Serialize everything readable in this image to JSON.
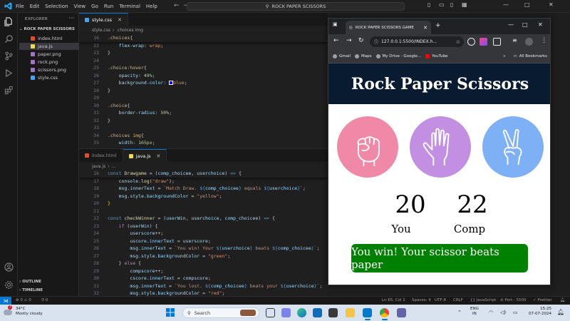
{
  "vscode": {
    "menus": [
      "File",
      "Edit",
      "Selection",
      "View",
      "Go",
      "Run",
      "Terminal",
      "Help"
    ],
    "command_center": "ROCK PAPER SCISSORS",
    "explorer": {
      "header": "EXPLORER",
      "folder": "ROCK PAPER SCISSORS",
      "files": [
        "index.html",
        "java.js",
        "paper.png",
        "rock.png",
        "scissors.png",
        "style.css"
      ],
      "outline": "OUTLINE",
      "timeline": "TIMELINE"
    },
    "editor_top": {
      "tab": "style.css",
      "crumbs": [
        "style.css",
        "›",
        ".choices img"
      ],
      "lines": [
        {
          "n": "16",
          "t": ".choices{"
        },
        {
          "n": "22",
          "t": "    flex-wrap: wrap;"
        },
        {
          "n": "23",
          "t": "}"
        },
        {
          "n": "24",
          "t": ""
        },
        {
          "n": "25",
          "t": ".choice:hover{"
        },
        {
          "n": "26",
          "t": "    opacity: 49%;"
        },
        {
          "n": "27",
          "t": "    background-color: blue;"
        },
        {
          "n": "28",
          "t": "}"
        },
        {
          "n": "29",
          "t": ""
        },
        {
          "n": "30",
          "t": ".choice{"
        },
        {
          "n": "31",
          "t": "    border-radius: 50%;"
        },
        {
          "n": "32",
          "t": "}"
        },
        {
          "n": "33",
          "t": ""
        },
        {
          "n": "34",
          "t": ".choices img{"
        },
        {
          "n": "35",
          "t": "    width: 165px;"
        },
        {
          "n": "36",
          "t": "    height: 165px;"
        }
      ]
    },
    "editor_bottom": {
      "tabs": [
        "index.html",
        "java.js"
      ],
      "crumbs": [
        "java.js",
        "›",
        "..."
      ],
      "lines": [
        {
          "n": "16",
          "t": "const Drawgame = (comp_choicee, userchoice) => {"
        },
        {
          "n": "17",
          "t": "    console.log(\"draw\");"
        },
        {
          "n": "18",
          "t": "    msg.innerText = `Match Draw. ${comp_choicee} equals ${userchoice}`;"
        },
        {
          "n": "19",
          "t": "    msg.style.backgroundColor = \"yellow\";"
        },
        {
          "n": "20",
          "t": "}"
        },
        {
          "n": "21",
          "t": ""
        },
        {
          "n": "22",
          "t": "const checkWinner = (userWin, userchoice, comp_choicee) => {"
        },
        {
          "n": "23",
          "t": "    if (userWin) {"
        },
        {
          "n": "24",
          "t": "        userscore++;"
        },
        {
          "n": "25",
          "t": "        uscore.innerText = userscore;"
        },
        {
          "n": "26",
          "t": "        msg.innerText = `You win! Your ${userchoice} beats ${comp_choicee}`;"
        },
        {
          "n": "27",
          "t": "        msg.style.backgroundColor = \"green\";"
        },
        {
          "n": "28",
          "t": "    } else {"
        },
        {
          "n": "29",
          "t": "        compscore++;"
        },
        {
          "n": "30",
          "t": "        cscore.innerText = compscore;"
        },
        {
          "n": "31",
          "t": "        msg.innerText = `You lost. ${comp_choicee} beats your ${userchoice}`;"
        },
        {
          "n": "32",
          "t": "        msg.style.backgroundColor = \"red\";"
        },
        {
          "n": "33",
          "t": "    }"
        }
      ]
    },
    "status": {
      "problems": "⊗ 0 ⚠ 0",
      "ports": "⚲ 0",
      "position": "Ln 65, Col 1",
      "spaces": "Spaces: 4",
      "encoding": "UTF-8",
      "eol": "CRLF",
      "language": "{} JavaScript",
      "port": "⊘ Port : 5500",
      "prettier": "✓ Prettier"
    }
  },
  "browser": {
    "tab_title": "ROCK PAPER SCISSORS GAME",
    "url": "127.0.0.1:5500/INDEX.h...",
    "bookmarks": [
      "Gmail",
      "Maps",
      "My Drive - Google...",
      "YouTube"
    ],
    "all_bookmarks": "All Bookmarks",
    "page": {
      "title": "Rock Paper Scissors",
      "user_score": "20",
      "comp_score": "22",
      "user_label": "You",
      "comp_label": "Comp",
      "message": "You win! Your scissor beats paper",
      "colors": {
        "rock": "#f088a8",
        "paper": "#c28fe3",
        "scissors": "#7eb0f5",
        "message_bg": "#008000",
        "header_bg": "#081b31"
      }
    }
  },
  "taskbar": {
    "temp": "34°C",
    "weather": "Mostly cloudy",
    "search": "Search",
    "lang1": "ENG",
    "lang2": "IN",
    "time": "15:25",
    "date": "07-07-2024"
  }
}
